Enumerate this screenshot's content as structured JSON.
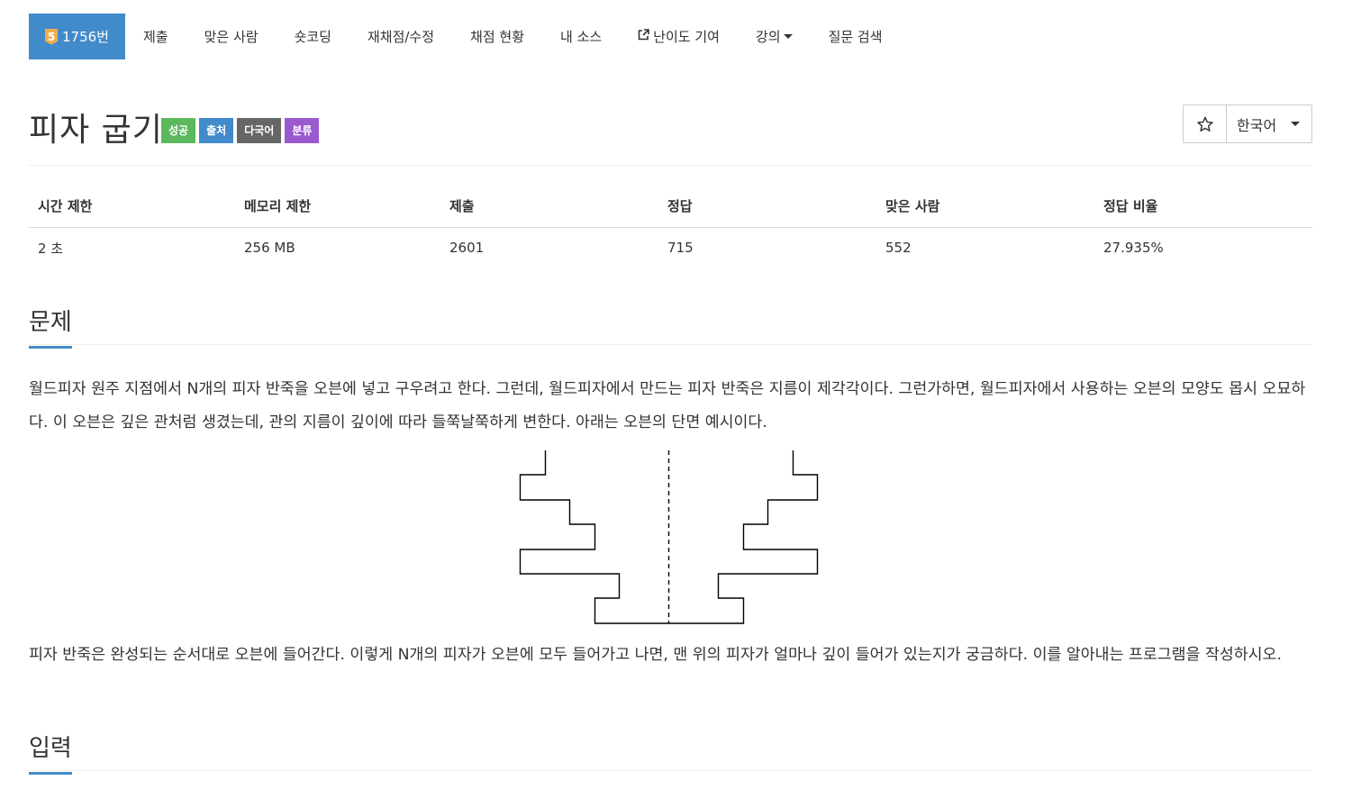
{
  "nav": {
    "problem_badge": "5",
    "problem_number": "1756번",
    "items": [
      "제출",
      "맞은 사람",
      "숏코딩",
      "재채점/수정",
      "채점 현황",
      "내 소스",
      "난이도 기여",
      "강의",
      "질문 검색"
    ]
  },
  "title": "피자 굽기",
  "labels": [
    "성공",
    "출처",
    "다국어",
    "분류"
  ],
  "lang_button": "한국어",
  "stats": {
    "headers": [
      "시간 제한",
      "메모리 제한",
      "제출",
      "정답",
      "맞은 사람",
      "정답 비율"
    ],
    "values": [
      "2 초",
      "256 MB",
      "2601",
      "715",
      "552",
      "27.935%"
    ]
  },
  "sections": {
    "problem": "문제",
    "input": "입력"
  },
  "problem_text_1": "월드피자 원주 지점에서 N개의 피자 반죽을 오븐에 넣고 구우려고 한다. 그런데, 월드피자에서 만드는 피자 반죽은 지름이 제각각이다. 그런가하면, 월드피자에서 사용하는 오븐의 모양도 몹시 오묘하다. 이 오븐은 깊은 관처럼 생겼는데, 관의 지름이 깊이에 따라 들쭉날쭉하게 변한다. 아래는 오븐의 단면 예시이다.",
  "problem_text_2": "피자 반죽은 완성되는 순서대로 오븐에 들어간다. 이렇게 N개의 피자가 오븐에 모두 들어가고 나면, 맨 위의 피자가 얼마나 깊이 들어가 있는지가 궁금하다. 이를 알아내는 프로그램을 작성하시오.",
  "colors": {
    "primary": "#428bca",
    "success": "#5cb85c",
    "multi": "#666666",
    "category": "#9b59d0",
    "badge": "#f0ad4e"
  }
}
